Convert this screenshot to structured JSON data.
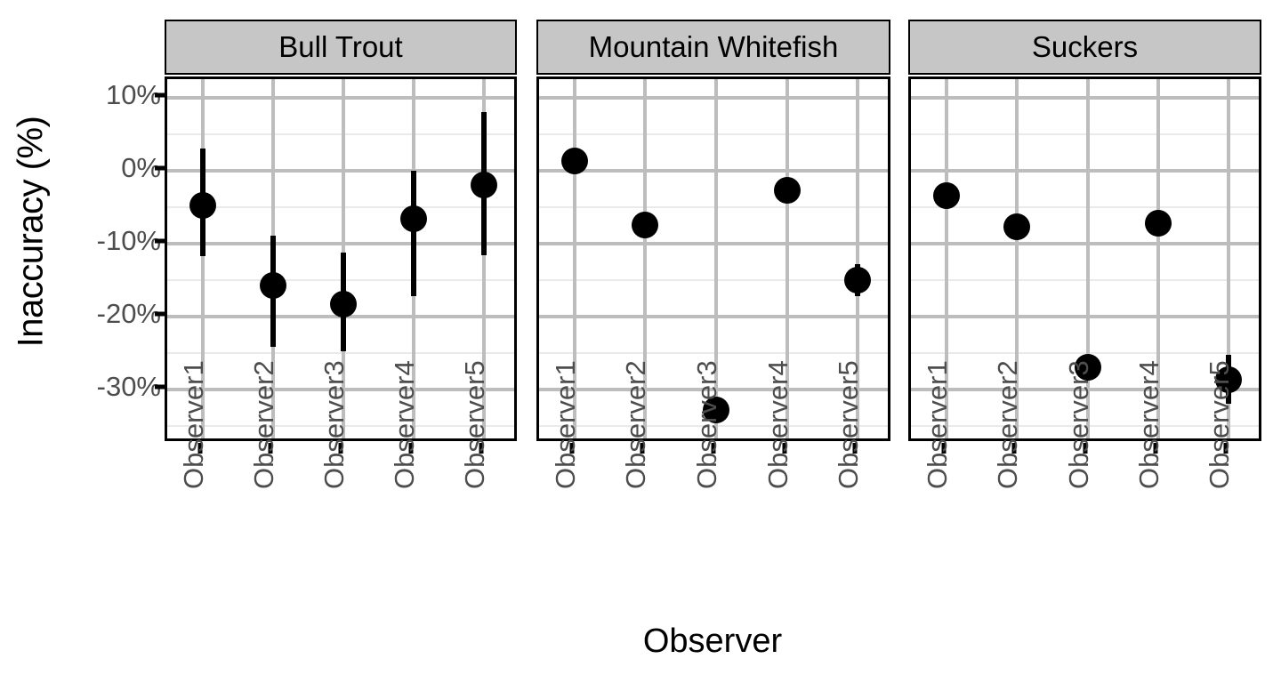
{
  "chart_data": {
    "type": "scatter",
    "title": "",
    "xlabel": "Observer",
    "ylabel": "Inaccuracy (%)",
    "ylim": [
      -37.5,
      12.5
    ],
    "grid": true,
    "legend": "none",
    "y_tick_labels": [
      "10%",
      "0%",
      "-10%",
      "-20%",
      "-30%"
    ],
    "y_tick_values": [
      10,
      0,
      -10,
      -20,
      -30
    ],
    "y_minor_values": [
      5,
      -5,
      -15,
      -25,
      -35
    ],
    "categories": [
      "Observer1",
      "Observer2",
      "Observer3",
      "Observer4",
      "Observer5"
    ],
    "facet_variable": "Species",
    "facets": [
      {
        "label": "Bull Trout",
        "points": [
          {
            "x": "Observer1",
            "y": -4.8,
            "ymin": -11.8,
            "ymax": 3.0
          },
          {
            "x": "Observer2",
            "y": -15.8,
            "ymin": -24.2,
            "ymax": -9.0
          },
          {
            "x": "Observer3",
            "y": -18.4,
            "ymin": -24.8,
            "ymax": -11.3
          },
          {
            "x": "Observer4",
            "y": -6.6,
            "ymin": -17.3,
            "ymax": -0.1
          },
          {
            "x": "Observer5",
            "y": -2.0,
            "ymin": -11.7,
            "ymax": 8.0
          }
        ]
      },
      {
        "label": "Mountain Whitefish",
        "points": [
          {
            "x": "Observer1",
            "y": 1.3,
            "ymin": 0.6,
            "ymax": 2.0
          },
          {
            "x": "Observer2",
            "y": -7.5,
            "ymin": -7.9,
            "ymax": -7.1
          },
          {
            "x": "Observer3",
            "y": -32.9,
            "ymin": -33.2,
            "ymax": -32.6
          },
          {
            "x": "Observer4",
            "y": -2.7,
            "ymin": -4.0,
            "ymax": -1.4
          },
          {
            "x": "Observer5",
            "y": -15.1,
            "ymin": -17.3,
            "ymax": -12.9
          }
        ]
      },
      {
        "label": "Suckers",
        "points": [
          {
            "x": "Observer1",
            "y": -3.5,
            "ymin": -4.0,
            "ymax": -3.0
          },
          {
            "x": "Observer2",
            "y": -7.7,
            "ymin": -8.1,
            "ymax": -7.3
          },
          {
            "x": "Observer3",
            "y": -27.0,
            "ymin": -27.4,
            "ymax": -26.6
          },
          {
            "x": "Observer4",
            "y": -7.2,
            "ymin": -8.9,
            "ymax": -5.5
          },
          {
            "x": "Observer5",
            "y": -28.7,
            "ymin": -32.0,
            "ymax": -25.3
          }
        ]
      }
    ]
  },
  "axes": {
    "y_title": "Inaccuracy (%)",
    "x_title": "Observer"
  },
  "style": {
    "point_color": "#000000",
    "strip_background": "#c6c6c6",
    "major_gridline_color": "#bdbdbd",
    "minor_gridline_color": "#eaeaea",
    "panel_border_color": "#000000",
    "tick_label_color": "#4d4d4d"
  }
}
